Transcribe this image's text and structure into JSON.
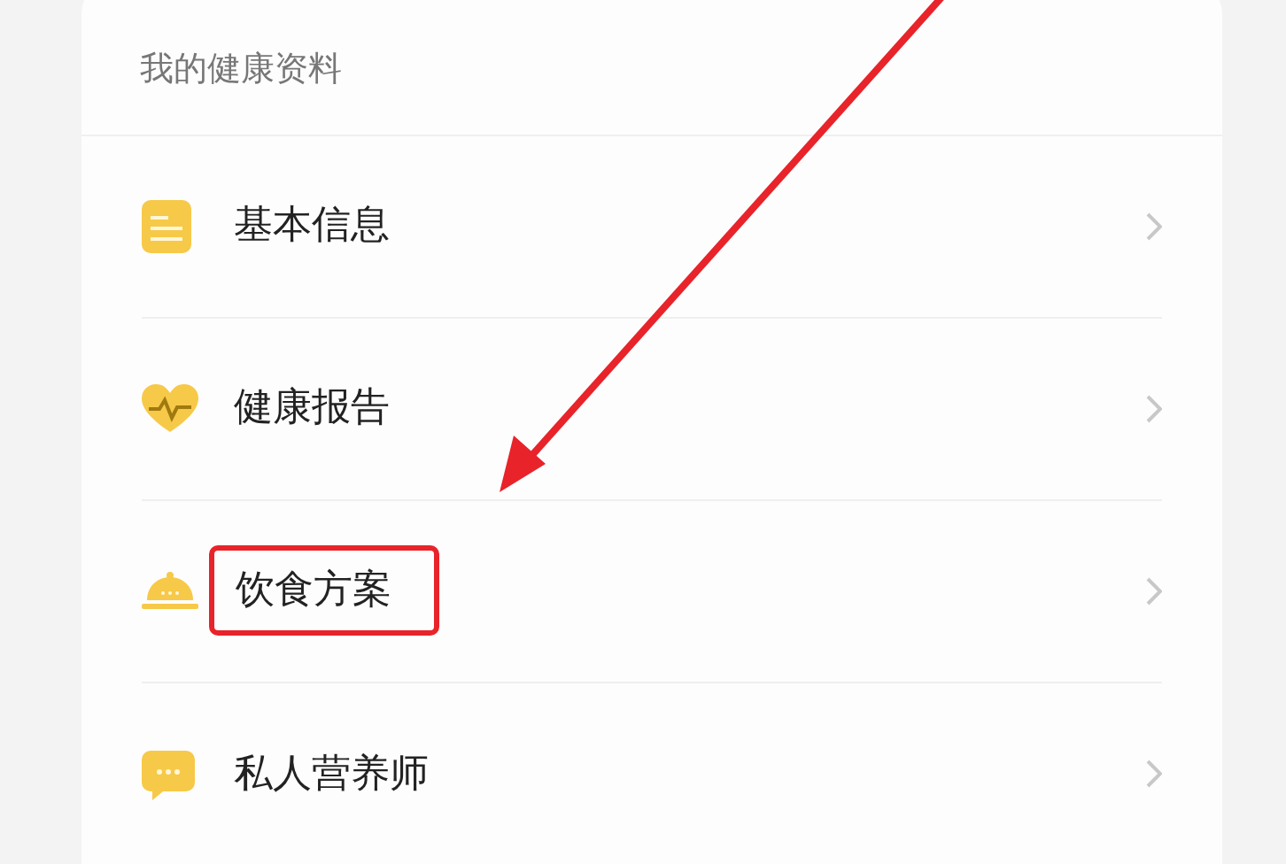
{
  "section": {
    "title": "我的健康资料"
  },
  "items": [
    {
      "label": "基本信息",
      "kind": "document",
      "highlighted": false
    },
    {
      "label": "健康报告",
      "kind": "heart",
      "highlighted": false
    },
    {
      "label": "饮食方案",
      "kind": "cloche",
      "highlighted": true
    },
    {
      "label": "私人营养师",
      "kind": "chat",
      "highlighted": false
    }
  ]
}
